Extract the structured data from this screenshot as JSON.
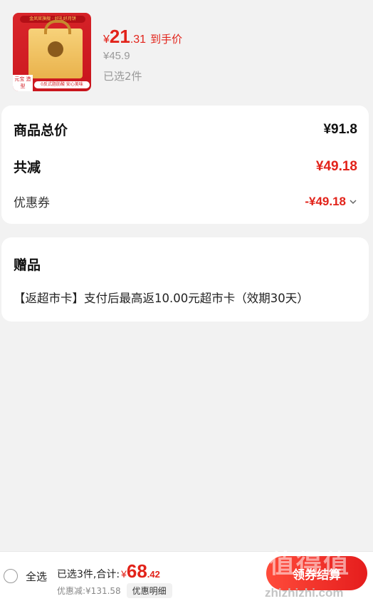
{
  "product": {
    "image_icon": "gift-box-image",
    "image_top_text": "金凤官旗舰 · 好礼好月饼",
    "image_tag": "元宝 造型",
    "image_bottom_text": "0反式脂肪酸 安心美味",
    "price_currency": "¥",
    "price_integer": "21",
    "price_decimal": ".31",
    "price_suffix": "到手价",
    "original_price": "¥45.9",
    "selected_count": "已选2件"
  },
  "summary": {
    "total_label": "商品总价",
    "total_value": "¥91.8",
    "reduce_label": "共减",
    "reduce_value": "¥49.18",
    "coupon_label": "优惠券",
    "coupon_value": "-¥49.18"
  },
  "gift": {
    "title": "赠品",
    "text": "【返超市卡】支付后最高返10.00元超市卡（效期30天）"
  },
  "bottom_bar": {
    "select_all_label": "全选",
    "total_prefix": "已选3件,合计:",
    "total_currency": "¥",
    "total_integer": "68",
    "total_decimal": ".42",
    "discount_text": "优惠减:¥131.58",
    "detail_button": "优惠明细",
    "settle_button": "领券结算"
  },
  "watermark": {
    "cn": "值得值",
    "en": "zhizhizhi.com"
  },
  "colors": {
    "accent_red": "#e2231a",
    "background": "#f2f2f2",
    "card": "#ffffff"
  }
}
